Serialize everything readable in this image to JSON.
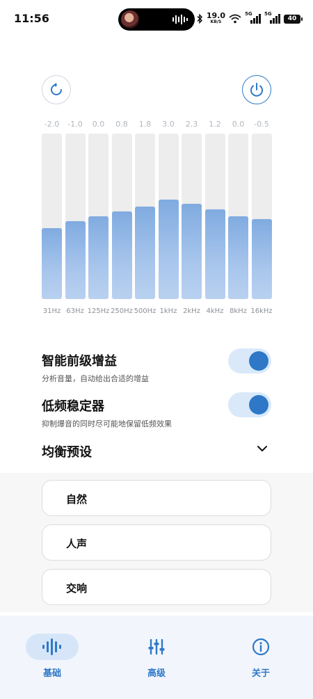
{
  "status": {
    "time": "11:56",
    "speed_value": "19.0",
    "speed_unit": "KB/S",
    "net1": "5G",
    "net2": "5G",
    "battery": "40"
  },
  "buttons": {
    "reset_icon": "refresh-icon",
    "power_icon": "power-icon"
  },
  "eq": {
    "values": [
      "-2.0",
      "-1.0",
      "0.0",
      "0.8",
      "1.8",
      "3.0",
      "2.3",
      "1.2",
      "0.0",
      "-0.5"
    ],
    "frequencies": [
      "31Hz",
      "63Hz",
      "125Hz",
      "250Hz",
      "500Hz",
      "1kHz",
      "2kHz",
      "4kHz",
      "8kHz",
      "16kHz"
    ],
    "fill_fraction": [
      0.43,
      0.47,
      0.5,
      0.53,
      0.56,
      0.6,
      0.575,
      0.54,
      0.5,
      0.485
    ]
  },
  "settings": {
    "smart_gain": {
      "title": "智能前级增益",
      "desc": "分析音量，自动给出合适的增益",
      "enabled": true
    },
    "bass_stabilizer": {
      "title": "低频稳定器",
      "desc": "抑制爆音的同时尽可能地保留低频效果",
      "enabled": true
    }
  },
  "presets": {
    "title": "均衡预设",
    "items": [
      "自然",
      "人声",
      "交响"
    ]
  },
  "nav": {
    "items": [
      {
        "label": "基础",
        "icon": "waveform-icon",
        "active": true
      },
      {
        "label": "高级",
        "icon": "sliders-icon",
        "active": false
      },
      {
        "label": "关于",
        "icon": "info-icon",
        "active": false
      }
    ]
  },
  "colors": {
    "accent": "#2e78c7",
    "toggle_track": "#d9e9fa",
    "eq_fill": "#9fc0ea"
  }
}
